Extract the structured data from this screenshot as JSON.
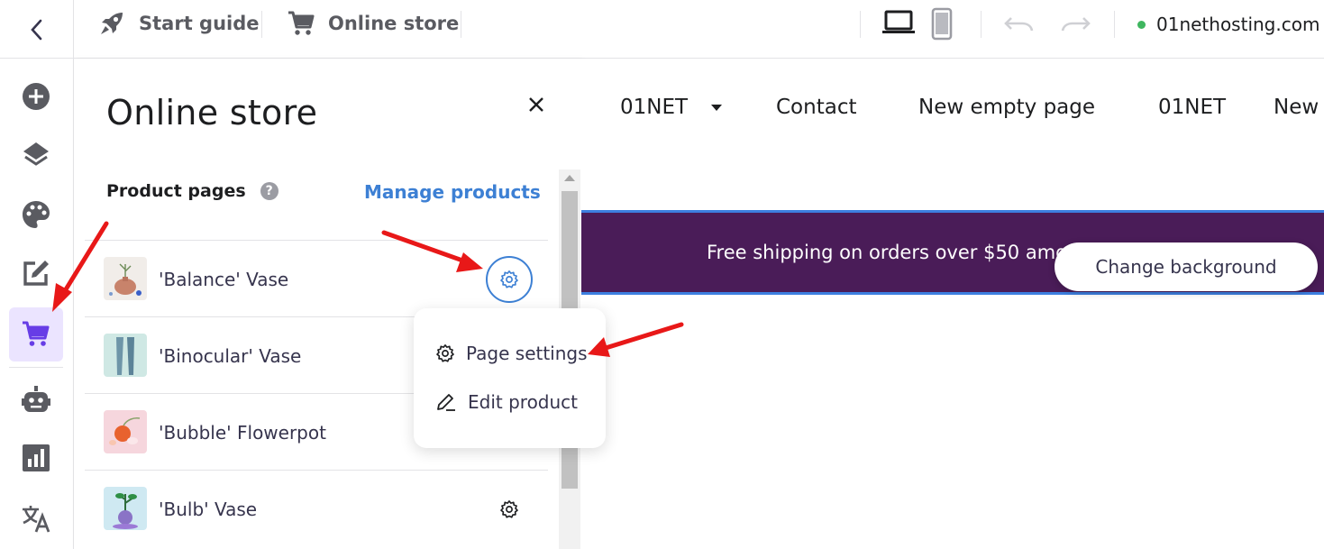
{
  "topbar": {
    "start_guide_label": "Start guide",
    "online_store_label": "Online store",
    "domain": "01nethosting.com",
    "status_color": "#3fb65f"
  },
  "rail": {
    "items": [
      {
        "name": "add",
        "icon": "plus-circle-icon"
      },
      {
        "name": "layers",
        "icon": "layers-icon"
      },
      {
        "name": "design",
        "icon": "palette-icon"
      },
      {
        "name": "edit",
        "icon": "edit-icon"
      },
      {
        "name": "store",
        "icon": "cart-icon",
        "active": true
      },
      {
        "name": "ai",
        "icon": "robot-icon"
      },
      {
        "name": "analytics",
        "icon": "chart-icon"
      },
      {
        "name": "translate",
        "icon": "translate-icon"
      }
    ]
  },
  "panel": {
    "title": "Online store",
    "section_label": "Product pages",
    "help_glyph": "?",
    "manage_link": "Manage products",
    "products": [
      {
        "name": "'Balance' Vase",
        "thumb_bg": "#f1ede9",
        "accent": "#c8836b"
      },
      {
        "name": "'Binocular' Vase",
        "thumb_bg": "#cfe8e4",
        "accent": "#6e95a8"
      },
      {
        "name": "'Bubble' Flowerpot",
        "thumb_bg": "#f6d6dd",
        "accent": "#e8622e"
      },
      {
        "name": "'Bulb' Vase",
        "thumb_bg": "#cfe9f2",
        "accent": "#8a73c6"
      }
    ]
  },
  "menu": {
    "page_settings": "Page settings",
    "edit_product": "Edit product"
  },
  "preview": {
    "nav": [
      "01NET",
      "Contact",
      "New empty page",
      "01NET",
      "New"
    ],
    "banner_text": "Free shipping on orders over $50 amo",
    "change_background": "Change background",
    "banner_color": "#4a1c58"
  }
}
